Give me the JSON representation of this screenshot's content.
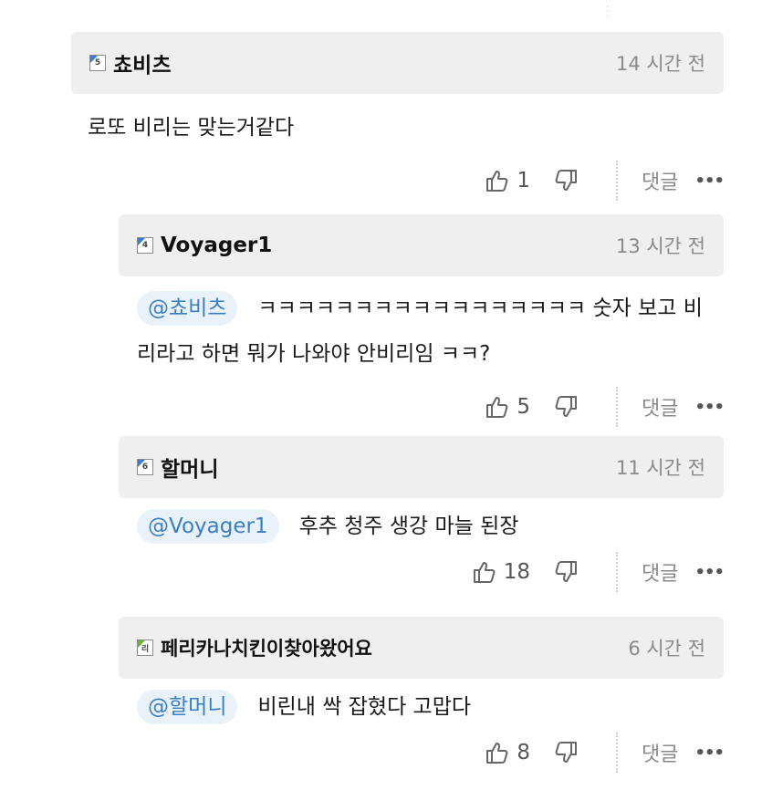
{
  "comments": [
    {
      "level": "5",
      "nickname": "쵸비츠",
      "time": "14 시간 전",
      "mention": "",
      "text": "로또 비리는 맞는거같다",
      "likes": "1",
      "reply_label": "댓글",
      "more_label": "•••"
    },
    {
      "level": "4",
      "nickname": "Voyager1",
      "time": "13 시간 전",
      "mention": "@쵸비츠",
      "text": "ㅋㅋㅋㅋㅋㅋㅋㅋㅋㅋㅋㅋㅋㅋㅋㅋㅋ 숫자 보고 비리라고 하면 뭐가 나와야 안비리임 ㅋㅋ?",
      "likes": "5",
      "reply_label": "댓글",
      "more_label": "•••"
    },
    {
      "level": "6",
      "nickname": "할머니",
      "time": "11 시간 전",
      "mention": "@Voyager1",
      "text": "후추 청주 생강 마늘 된장",
      "likes": "18",
      "reply_label": "댓글",
      "more_label": "•••"
    },
    {
      "level": "리",
      "nickname": "페리카나치킨이찾아왔어요",
      "time": "6 시간 전",
      "mention": "@할머니",
      "text": "비린내 싹 잡혔다 고맙다",
      "likes": "8",
      "reply_label": "댓글",
      "more_label": "•••"
    }
  ],
  "colors": {
    "header_bg": "#efefef",
    "mention_bg": "#e9f1f9",
    "mention_text": "#3a7fc4",
    "level_badge_blue": "#3a7bd5",
    "level_badge_green": "#69b42e"
  }
}
